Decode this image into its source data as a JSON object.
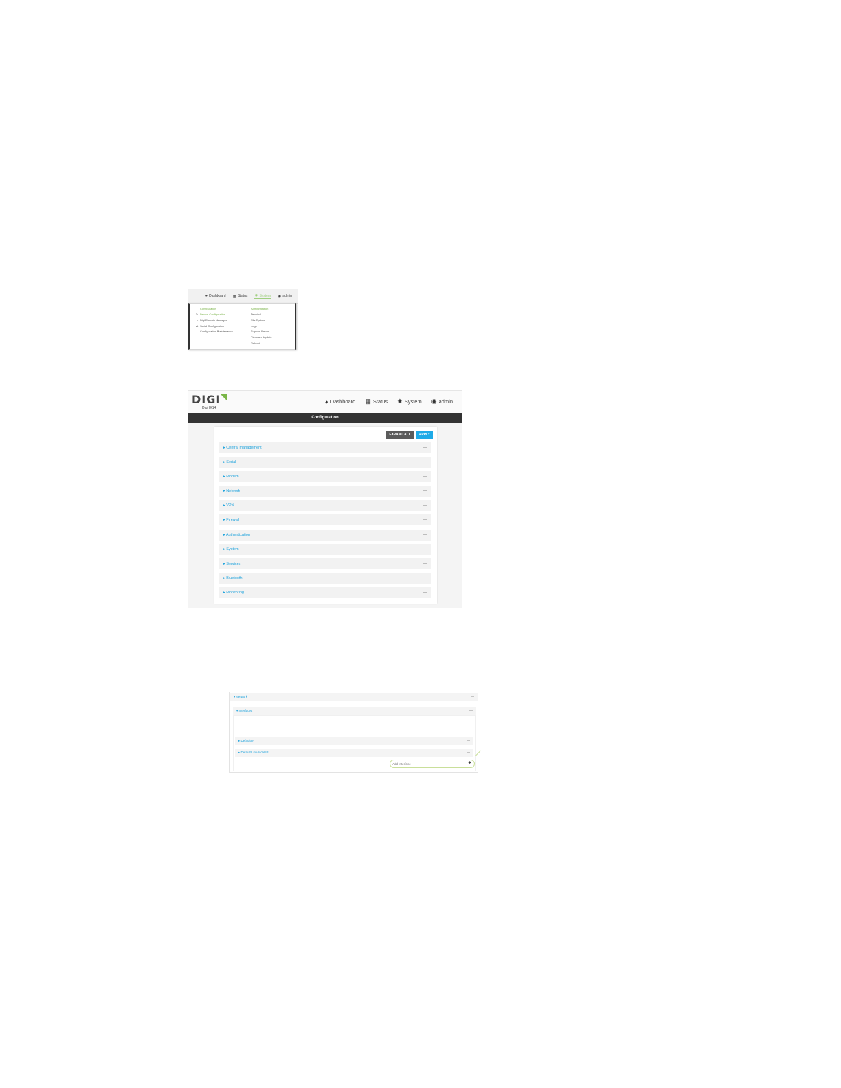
{
  "menu_screenshot": {
    "nav": {
      "dashboard": "Dashboard",
      "status": "Status",
      "system": "System",
      "admin": "admin"
    },
    "configuration": {
      "header": "Configuration",
      "items": [
        "Device Configuration",
        "Digi Remote Manager",
        "Serial Configuration",
        "Configuration Maintenance"
      ]
    },
    "administration": {
      "header": "Administration",
      "items": [
        "Terminal",
        "File System",
        "Logs",
        "Support Report",
        "Firmware Update",
        "Reboot"
      ]
    }
  },
  "config_screenshot": {
    "logo": {
      "word": "DIGI",
      "model": "Digi IX14"
    },
    "nav": {
      "dashboard": "Dashboard",
      "status": "Status",
      "system": "System",
      "admin": "admin"
    },
    "title": "Configuration",
    "buttons": {
      "expand_all": "EXPAND ALL",
      "apply": "APPLY"
    },
    "sections": [
      "Central management",
      "Serial",
      "Modem",
      "Network",
      "VPN",
      "Firewall",
      "Authentication",
      "System",
      "Services",
      "Bluetooth",
      "Monitoring"
    ],
    "collapse_symbol": "—"
  },
  "network_screenshot": {
    "network": "Network",
    "interfaces": "Interfaces",
    "default_ip": "Default IP",
    "default_link_local_ip": "Default Link-local IP",
    "add_placeholder": "Add Interface",
    "add_symbol": "+",
    "collapse_symbol": "—"
  },
  "colors": {
    "accent_blue": "#1eaae7",
    "digi_green": "#7ab648",
    "header_dark": "#333333"
  }
}
